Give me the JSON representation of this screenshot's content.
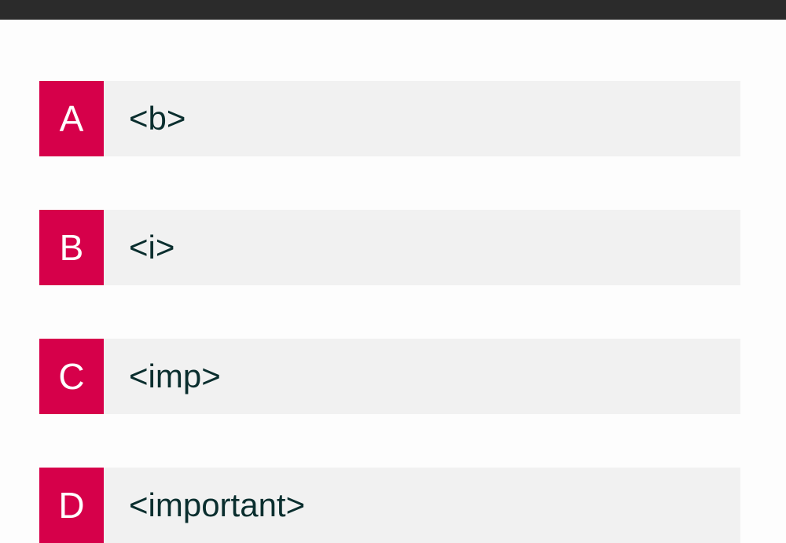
{
  "options": [
    {
      "letter": "A",
      "text": "<b>"
    },
    {
      "letter": "B",
      "text": "<i>"
    },
    {
      "letter": "C",
      "text": "<imp>"
    },
    {
      "letter": "D",
      "text": "<important>"
    }
  ]
}
